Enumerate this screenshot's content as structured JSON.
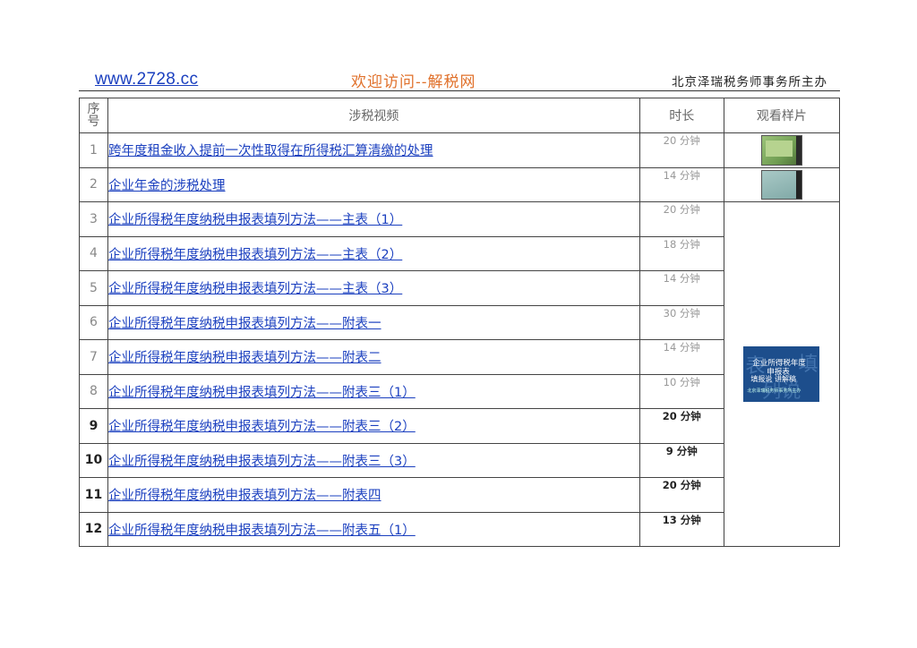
{
  "header": {
    "site_link": "www.2728.cc",
    "welcome": "欢迎访问--解税网",
    "sponsor": "北京泽瑞税务师事务所主办"
  },
  "table": {
    "headers": {
      "no": "序\n号",
      "title": "涉税视频",
      "duration": "时长",
      "sample": "观看样片"
    },
    "rows": [
      {
        "no": "1",
        "title": "跨年度租金收入提前一次性取得在所得税汇算清缴的处理",
        "duration": "20 分钟"
      },
      {
        "no": "2",
        "title": "企业年金的涉税处理",
        "duration": "14 分钟"
      },
      {
        "no": "3",
        "title": "企业所得税年度纳税申报表填列方法——主表（1）",
        "duration": "20 分钟"
      },
      {
        "no": "4",
        "title": "企业所得税年度纳税申报表填列方法——主表（2）",
        "duration": "18 分钟"
      },
      {
        "no": "5",
        "title": "企业所得税年度纳税申报表填列方法——主表（3）",
        "duration": "14 分钟"
      },
      {
        "no": "6",
        "title": "企业所得税年度纳税申报表填列方法——附表一",
        "duration": "30 分钟"
      },
      {
        "no": "7",
        "title": "企业所得税年度纳税申报表填列方法——附表二",
        "duration": "14 分钟"
      },
      {
        "no": "8",
        "title": "企业所得税年度纳税申报表填列方法——附表三（1）",
        "duration": "10 分钟"
      },
      {
        "no": "9",
        "title": "企业所得税年度纳税申报表填列方法——附表三（2）",
        "duration": "20 分钟"
      },
      {
        "no": "10",
        "title": "企业所得税年度纳税申报表填列方法——附表三（3）",
        "duration": "9 分钟"
      },
      {
        "no": "11",
        "title": "企业所得税年度纳税申报表填列方法——附表四",
        "duration": "20 分钟"
      },
      {
        "no": "12",
        "title": "企业所得税年度纳税申报表填列方法——附表五（1）",
        "duration": "13 分钟"
      }
    ]
  },
  "sample_thumb": {
    "line1": "企业所得税年度",
    "line2": "申报表",
    "line3": "填报说  讲解稿",
    "line4": "北京泽瑞税务师事务所主办",
    "bg_left": "表",
    "bg_right": "填",
    "bg_bottom": "列说"
  }
}
